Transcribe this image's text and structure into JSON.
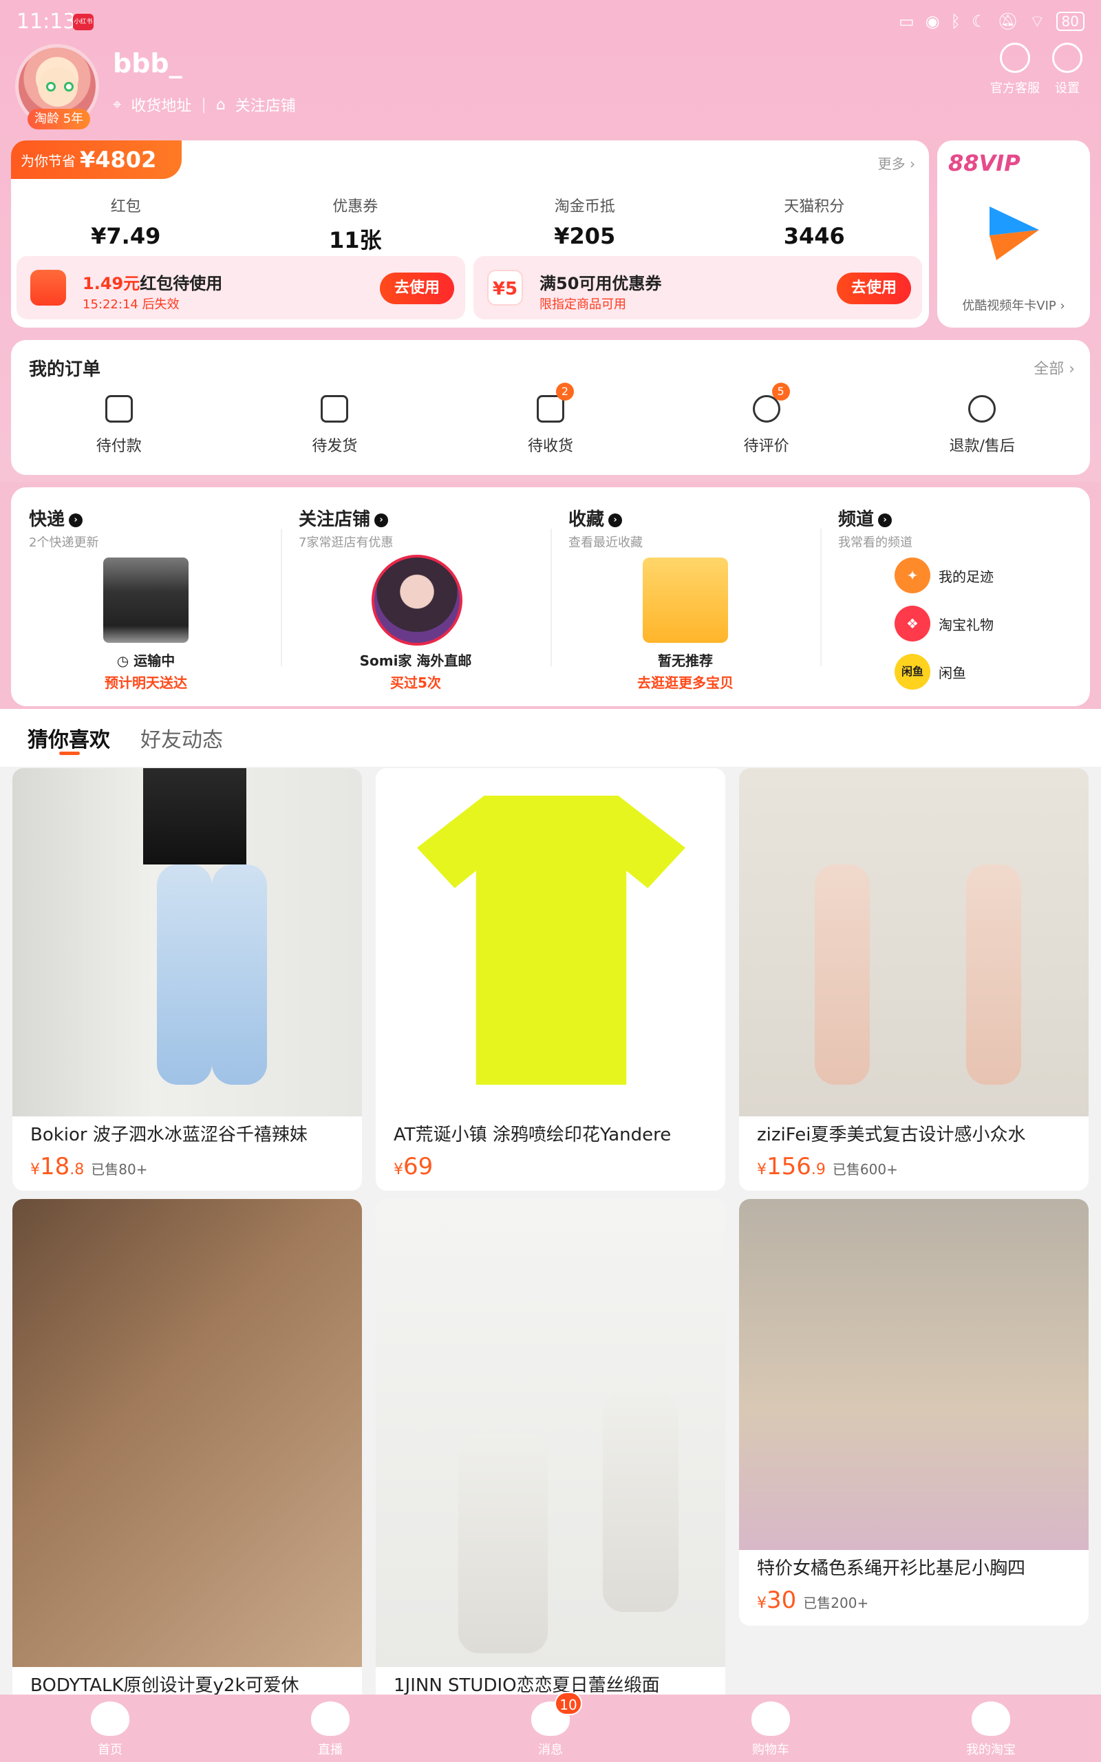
{
  "status_bar": {
    "time": "11:13",
    "app_badge": "小红书",
    "battery": "80"
  },
  "profile": {
    "username": "bbb_",
    "age_badge": "淘龄 5年",
    "address_link": "收货地址",
    "follow_shop_link": "关注店铺",
    "customer_service": "官方客服",
    "settings": "设置"
  },
  "savings": {
    "label": "为你节省",
    "amount": "¥4802",
    "more": "更多 ›",
    "stats": [
      {
        "label": "红包",
        "value": "¥7.49"
      },
      {
        "label": "优惠券",
        "value": "11张"
      },
      {
        "label": "淘金币抵",
        "value": "¥205"
      },
      {
        "label": "天猫积分",
        "value": "3446"
      }
    ],
    "promo1": {
      "title_red": "1.49元",
      "title_rest": "红包待使用",
      "sub": "15:22:14 后失效",
      "button": "去使用"
    },
    "promo2": {
      "icon": "¥5",
      "title": "满50可用优惠券",
      "sub": "限指定商品可用",
      "button": "去使用"
    }
  },
  "vip": {
    "title": "88VIP",
    "desc": "优酷视频年卡VIP ›"
  },
  "orders": {
    "title": "我的订单",
    "all": "全部 ›",
    "items": [
      {
        "label": "待付款",
        "badge": ""
      },
      {
        "label": "待发货",
        "badge": ""
      },
      {
        "label": "待收货",
        "badge": "2"
      },
      {
        "label": "待评价",
        "badge": "5"
      },
      {
        "label": "退款/售后",
        "badge": ""
      }
    ]
  },
  "quick": {
    "express": {
      "title": "快递",
      "sub": "2个快递更新",
      "cap1": "运输中",
      "cap2": "预计明天送达"
    },
    "shops": {
      "title": "关注店铺",
      "sub": "7家常逛店有优惠",
      "cap1": "Somi家 海外直邮",
      "cap2": "买过5次"
    },
    "favorites": {
      "title": "收藏",
      "sub": "查看最近收藏",
      "cap1": "暂无推荐",
      "cap2": "去逛逛更多宝贝"
    },
    "channels": {
      "title": "频道",
      "sub": "我常看的频道",
      "items": [
        {
          "label": "我的足迹",
          "color": "#ff8a2a"
        },
        {
          "label": "淘宝礼物",
          "color": "#ff3a4a"
        },
        {
          "label": "闲鱼",
          "color": "#ffd21e",
          "icon_text": "闲鱼"
        }
      ]
    }
  },
  "feed_tabs": {
    "active": "猜你喜欢",
    "inactive": "好友动态"
  },
  "products": [
    {
      "title": "Bokior 波子泗水冰蓝涩谷千禧辣妹",
      "sym": "¥",
      "price": "18",
      "decimal": ".8",
      "sold": "已售80+"
    },
    {
      "title": "AT荒诞小镇 涂鸦喷绘印花Yandere",
      "sym": "¥",
      "price": "69",
      "decimal": "",
      "sold": ""
    },
    {
      "title": "ziziFei夏季美式复古设计感小众水",
      "sym": "¥",
      "price": "156",
      "decimal": ".9",
      "sold": "已售600+"
    },
    {
      "title": "BODYTALK原创设计夏y2k可爱休",
      "sym": "",
      "price": "",
      "decimal": "",
      "sold": ""
    },
    {
      "title": "1JINN STUDIO恋恋夏日蕾丝缎面",
      "sym": "",
      "price": "",
      "decimal": "",
      "sold": ""
    },
    {
      "title": "特价女橘色系绳开衫比基尼小胸四",
      "sym": "¥",
      "price": "30",
      "decimal": "",
      "sold": "已售200+"
    }
  ],
  "bottom_nav": [
    {
      "label": "首页",
      "badge": ""
    },
    {
      "label": "直播",
      "badge": ""
    },
    {
      "label": "消息",
      "badge": "10"
    },
    {
      "label": "购物车",
      "badge": ""
    },
    {
      "label": "我的淘宝",
      "badge": ""
    }
  ]
}
